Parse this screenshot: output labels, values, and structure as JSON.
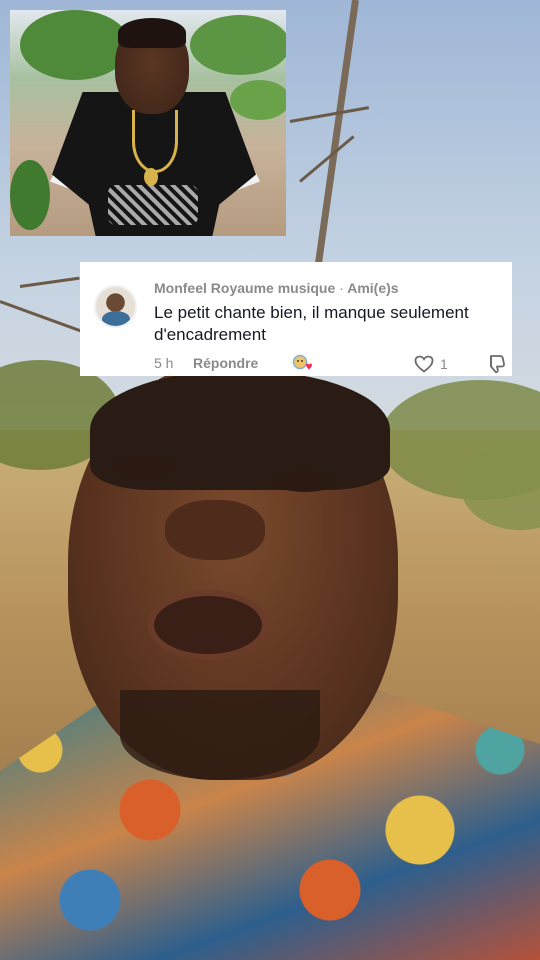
{
  "comment": {
    "author": "Monfeel Royaume musique",
    "separator": "·",
    "relation": "Ami(e)s",
    "text": "Le petit chante bien, il manque seulement d'encadrement",
    "time": "5 h",
    "reply_label": "Répondre",
    "like_count": "1"
  },
  "icons": {
    "like": "heart-outline-icon",
    "dislike": "thumbs-down-outline-icon",
    "reaction": "emoji-reaction-icon"
  },
  "colors": {
    "card_bg": "#ffffff",
    "text_primary": "#161823",
    "text_secondary": "#8a8a8a"
  }
}
